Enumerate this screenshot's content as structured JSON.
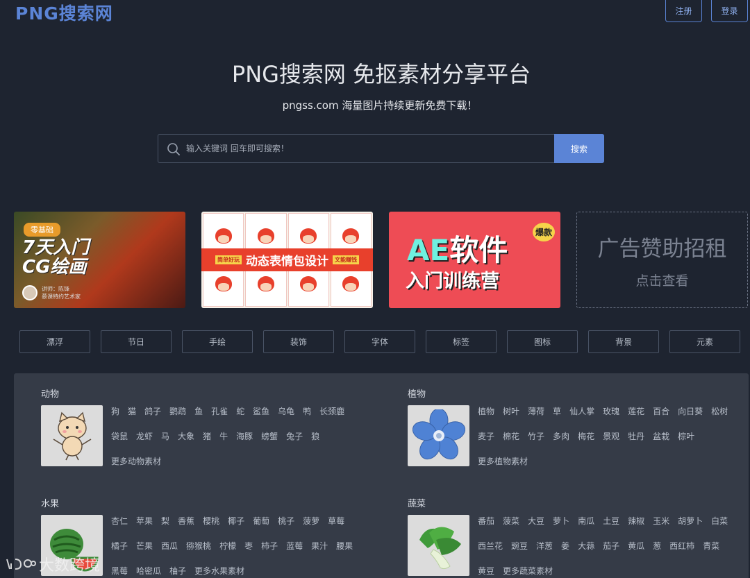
{
  "header": {
    "logo": "PNG搜索网",
    "register_label": "注册",
    "login_label": "登录"
  },
  "hero": {
    "title": "PNG搜索网 免抠素材分享平台",
    "subtitle": "pngss.com 海量图片持续更新免费下载！"
  },
  "search": {
    "placeholder": "输入关键词 回车即可搜索！",
    "value": "",
    "button_label": "搜索"
  },
  "banners": {
    "b1": {
      "tag": "零基础",
      "title_line1": "7天入门",
      "title_line2": "CG绘画",
      "lecturer": "讲师：陈锋",
      "lecturer_sub": "慕课特约艺术家"
    },
    "b2": {
      "title": "动态表情包设计",
      "left_side": "简单好玩",
      "right_side": "文能赚钱"
    },
    "b3": {
      "ae": "AE",
      "title": "软件",
      "sub": "入门训练营",
      "tag": "爆款"
    },
    "b4": {
      "title": "广告赞助招租",
      "sub": "点击查看"
    }
  },
  "tags": [
    "漂浮",
    "节日",
    "手绘",
    "装饰",
    "字体",
    "标签",
    "图标",
    "背景",
    "元素"
  ],
  "categories": [
    {
      "title": "动物",
      "links": [
        "狗",
        "猫",
        "鸽子",
        "鹦鹉",
        "鱼",
        "孔雀",
        "蛇",
        "鲨鱼",
        "乌龟",
        "鸭",
        "长颈鹿",
        "袋鼠",
        "龙虾",
        "马",
        "大象",
        "猪",
        "牛",
        "海豚",
        "螃蟹",
        "兔子",
        "狼",
        "更多动物素材"
      ]
    },
    {
      "title": "植物",
      "links": [
        "植物",
        "树叶",
        "薄荷",
        "草",
        "仙人掌",
        "玫瑰",
        "莲花",
        "百合",
        "向日葵",
        "松树",
        "麦子",
        "棉花",
        "竹子",
        "多肉",
        "梅花",
        "景观",
        "牡丹",
        "盆栽",
        "棕叶",
        "更多植物素材"
      ]
    },
    {
      "title": "水果",
      "links": [
        "杏仁",
        "苹果",
        "梨",
        "香蕉",
        "樱桃",
        "椰子",
        "葡萄",
        "桃子",
        "菠萝",
        "草莓",
        "橘子",
        "芒果",
        "西瓜",
        "猕猴桃",
        "柠檬",
        "枣",
        "柿子",
        "蓝莓",
        "果汁",
        "腰果",
        "黑莓",
        "哈密瓜",
        "柚子",
        "更多水果素材"
      ]
    },
    {
      "title": "蔬菜",
      "links": [
        "番茄",
        "菠菜",
        "大豆",
        "萝卜",
        "南瓜",
        "土豆",
        "辣椒",
        "玉米",
        "胡萝卜",
        "白菜",
        "西兰花",
        "豌豆",
        "洋葱",
        "姜",
        "大蒜",
        "茄子",
        "黄瓜",
        "葱",
        "西红柿",
        "青菜",
        "黄豆",
        "更多蔬菜素材"
      ]
    }
  ],
  "watermark": "大数跨境"
}
